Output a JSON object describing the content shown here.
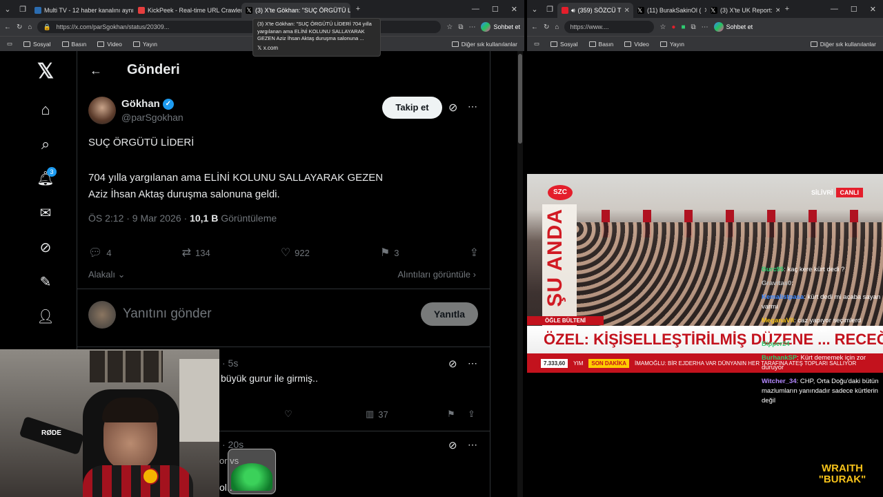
{
  "left_browser": {
    "tabs": [
      {
        "title": "Multi TV - 12 haber kanalını aynı a",
        "active": false,
        "fav_color": "#2b6cb0"
      },
      {
        "title": "KickPeek - Real-time URL Crawler",
        "active": false,
        "fav_color": "#e53e3e"
      },
      {
        "title": "(3) X'te Gökhan: \"SUÇ ÖRGÜTÜ Lİ",
        "active": true,
        "fav_color": "#000000"
      }
    ],
    "new_tab": "+",
    "url": "https://x.com/parSgokhan/status/20309...",
    "copilot": "Sohbet et",
    "bookmarks": [
      "Sosyal",
      "Basın",
      "Video",
      "Yayın"
    ],
    "other_bookmarks": "Diğer sık kullanılanlar"
  },
  "tooltip": {
    "text": "(3) X'te Gökhan: \"SUÇ ÖRGÜTÜ LİDERİ 704 yılla yargılanan ama ELİNİ KOLUNU SALLAYARAK GEZEN Aziz İhsan Aktaş duruşma salonuna ...",
    "domain": "x.com"
  },
  "x_nav": {
    "notification_count": "3"
  },
  "post": {
    "page_title": "Gönderi",
    "author_name": "Gökhan",
    "author_handle": "@parSgokhan",
    "follow_label": "Takip et",
    "line1": "SUÇ ÖRGÜTÜ LİDERİ",
    "line2": "704 yılla yargılanan ama ELİNİ KOLUNU SALLAYARAK GEZEN",
    "line3": "Aziz İhsan Aktaş duruşma salonuna geldi.",
    "time": "ÖS 2:12 · 9 Mar 2026 · ",
    "views": "10,1 B",
    "views_label": " Görüntüleme",
    "replies": "4",
    "reposts": "134",
    "likes": "922",
    "bookmarks": "3",
    "relevant_label": "Alakalı",
    "quotes_label": "Alıntıları görüntüle",
    "reply_placeholder": "Yanıtını gönder",
    "reply_button": "Yanıtla"
  },
  "reply1": {
    "time": "· 5s",
    "text": "büyük gurur ile girmiş..",
    "views": "37"
  },
  "reply2": {
    "time": "· 20s",
    "text1": "or vs",
    "text2": "ol.."
  },
  "webcam": {
    "mic_label": "RØDE"
  },
  "right_browser": {
    "tabs": [
      {
        "title": "(359) SÖZCÜ T",
        "active": true,
        "fav_color": "#e41e2b"
      },
      {
        "title": "(11) BurakSakinOl (",
        "active": false,
        "fav_color": "#000000"
      },
      {
        "title": "(3) X'te UK Report:",
        "active": false,
        "fav_color": "#000000"
      }
    ],
    "url": "https://www....",
    "copilot": "Sohbet et",
    "bookmarks": [
      "Sosyal",
      "Basın",
      "Video",
      "Yayın"
    ],
    "other_bookmarks": "Diğer sık kullanılanlar"
  },
  "tv": {
    "logo": "SZC",
    "vertical": "ŞU ANDA",
    "location": "SİLİVRİ",
    "live": "CANLI",
    "segment": "ÖĞLE BÜLTENİ",
    "headline": "ÖZEL: KİŞİSELLEŞTİRİLMİŞ DÜZENE ... RECEĞİZ",
    "ticker_price": "7.333,60",
    "ticker_text1": "YIM",
    "ticker_breaking": "SON DAKİKA",
    "ticker_text2": "İMAMOĞLU: BİR EJDERHA VAR DÜNYANIN HER TARAFINA ATEŞ TOPLARI SALLIYOR"
  },
  "chat": [
    {
      "user": "Burc95",
      "color": "#2ecc71",
      "msg": "kaç kere kürt dedi ?"
    },
    {
      "user": "Gravitas0",
      "color": "#bbbbbb",
      "msg": ""
    },
    {
      "user": "Kemalistpasa",
      "color": "#3a86ff",
      "msg": "kürt dedi mi acaba sayan varmı"
    },
    {
      "user": "MeganaVII",
      "color": "#f6c21a",
      "msg": "caz yapıyor seçimlerd yenilince çok eğlenceli"
    },
    {
      "user": "Bipper24",
      "color": "#2ecc71",
      "msg": ""
    },
    {
      "user": "BurhankSP",
      "color": "#2ecc71",
      "msg": "Kürt dememek için zor duruyor"
    },
    {
      "user": "Witcher_34",
      "color": "#b388ff",
      "msg": "CHP, Orta Doğu'daki bütün mazlumların yanındadır sadece kürtlerin değil"
    }
  ],
  "overlay": {
    "line1": "WRAITH",
    "line2": "\"BURAK\""
  }
}
